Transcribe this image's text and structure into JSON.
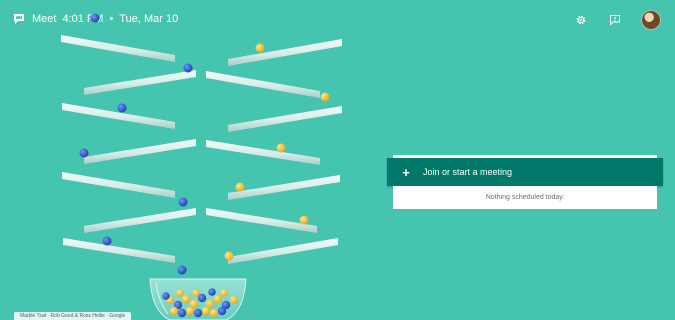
{
  "topbar": {
    "app_name": "Meet",
    "time": "4:01 PM",
    "separator": "•",
    "date": "Tue, Mar 10",
    "icons": [
      "meet-logo-icon",
      "gear-icon",
      "feedback-icon",
      "avatar"
    ]
  },
  "panel": {
    "join_icon": "+",
    "join_label": "Join or start a meeting",
    "schedule_text": "Nothing scheduled today."
  },
  "credit": {
    "text": "Marble Trail · Rob Good & Ross Hollie · Google"
  },
  "colors": {
    "background": "#45c4b0",
    "primary": "#00796b",
    "card": "#ffffff",
    "marble_blue": "#2b57c8",
    "marble_yellow": "#f2c230"
  }
}
